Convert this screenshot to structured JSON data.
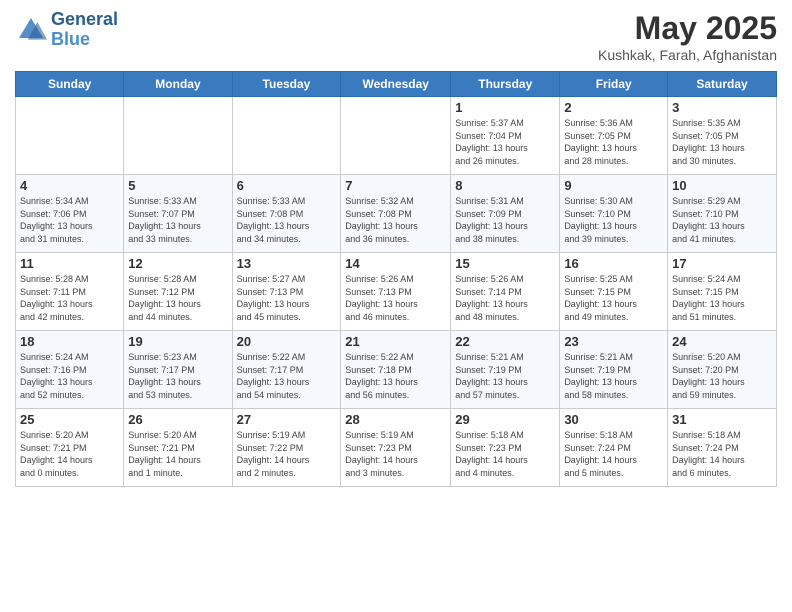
{
  "header": {
    "logo_line1": "General",
    "logo_line2": "Blue",
    "month": "May 2025",
    "location": "Kushkak, Farah, Afghanistan"
  },
  "weekdays": [
    "Sunday",
    "Monday",
    "Tuesday",
    "Wednesday",
    "Thursday",
    "Friday",
    "Saturday"
  ],
  "weeks": [
    [
      {
        "day": "",
        "info": ""
      },
      {
        "day": "",
        "info": ""
      },
      {
        "day": "",
        "info": ""
      },
      {
        "day": "",
        "info": ""
      },
      {
        "day": "1",
        "info": "Sunrise: 5:37 AM\nSunset: 7:04 PM\nDaylight: 13 hours\nand 26 minutes."
      },
      {
        "day": "2",
        "info": "Sunrise: 5:36 AM\nSunset: 7:05 PM\nDaylight: 13 hours\nand 28 minutes."
      },
      {
        "day": "3",
        "info": "Sunrise: 5:35 AM\nSunset: 7:05 PM\nDaylight: 13 hours\nand 30 minutes."
      }
    ],
    [
      {
        "day": "4",
        "info": "Sunrise: 5:34 AM\nSunset: 7:06 PM\nDaylight: 13 hours\nand 31 minutes."
      },
      {
        "day": "5",
        "info": "Sunrise: 5:33 AM\nSunset: 7:07 PM\nDaylight: 13 hours\nand 33 minutes."
      },
      {
        "day": "6",
        "info": "Sunrise: 5:33 AM\nSunset: 7:08 PM\nDaylight: 13 hours\nand 34 minutes."
      },
      {
        "day": "7",
        "info": "Sunrise: 5:32 AM\nSunset: 7:08 PM\nDaylight: 13 hours\nand 36 minutes."
      },
      {
        "day": "8",
        "info": "Sunrise: 5:31 AM\nSunset: 7:09 PM\nDaylight: 13 hours\nand 38 minutes."
      },
      {
        "day": "9",
        "info": "Sunrise: 5:30 AM\nSunset: 7:10 PM\nDaylight: 13 hours\nand 39 minutes."
      },
      {
        "day": "10",
        "info": "Sunrise: 5:29 AM\nSunset: 7:10 PM\nDaylight: 13 hours\nand 41 minutes."
      }
    ],
    [
      {
        "day": "11",
        "info": "Sunrise: 5:28 AM\nSunset: 7:11 PM\nDaylight: 13 hours\nand 42 minutes."
      },
      {
        "day": "12",
        "info": "Sunrise: 5:28 AM\nSunset: 7:12 PM\nDaylight: 13 hours\nand 44 minutes."
      },
      {
        "day": "13",
        "info": "Sunrise: 5:27 AM\nSunset: 7:13 PM\nDaylight: 13 hours\nand 45 minutes."
      },
      {
        "day": "14",
        "info": "Sunrise: 5:26 AM\nSunset: 7:13 PM\nDaylight: 13 hours\nand 46 minutes."
      },
      {
        "day": "15",
        "info": "Sunrise: 5:26 AM\nSunset: 7:14 PM\nDaylight: 13 hours\nand 48 minutes."
      },
      {
        "day": "16",
        "info": "Sunrise: 5:25 AM\nSunset: 7:15 PM\nDaylight: 13 hours\nand 49 minutes."
      },
      {
        "day": "17",
        "info": "Sunrise: 5:24 AM\nSunset: 7:15 PM\nDaylight: 13 hours\nand 51 minutes."
      }
    ],
    [
      {
        "day": "18",
        "info": "Sunrise: 5:24 AM\nSunset: 7:16 PM\nDaylight: 13 hours\nand 52 minutes."
      },
      {
        "day": "19",
        "info": "Sunrise: 5:23 AM\nSunset: 7:17 PM\nDaylight: 13 hours\nand 53 minutes."
      },
      {
        "day": "20",
        "info": "Sunrise: 5:22 AM\nSunset: 7:17 PM\nDaylight: 13 hours\nand 54 minutes."
      },
      {
        "day": "21",
        "info": "Sunrise: 5:22 AM\nSunset: 7:18 PM\nDaylight: 13 hours\nand 56 minutes."
      },
      {
        "day": "22",
        "info": "Sunrise: 5:21 AM\nSunset: 7:19 PM\nDaylight: 13 hours\nand 57 minutes."
      },
      {
        "day": "23",
        "info": "Sunrise: 5:21 AM\nSunset: 7:19 PM\nDaylight: 13 hours\nand 58 minutes."
      },
      {
        "day": "24",
        "info": "Sunrise: 5:20 AM\nSunset: 7:20 PM\nDaylight: 13 hours\nand 59 minutes."
      }
    ],
    [
      {
        "day": "25",
        "info": "Sunrise: 5:20 AM\nSunset: 7:21 PM\nDaylight: 14 hours\nand 0 minutes."
      },
      {
        "day": "26",
        "info": "Sunrise: 5:20 AM\nSunset: 7:21 PM\nDaylight: 14 hours\nand 1 minute."
      },
      {
        "day": "27",
        "info": "Sunrise: 5:19 AM\nSunset: 7:22 PM\nDaylight: 14 hours\nand 2 minutes."
      },
      {
        "day": "28",
        "info": "Sunrise: 5:19 AM\nSunset: 7:23 PM\nDaylight: 14 hours\nand 3 minutes."
      },
      {
        "day": "29",
        "info": "Sunrise: 5:18 AM\nSunset: 7:23 PM\nDaylight: 14 hours\nand 4 minutes."
      },
      {
        "day": "30",
        "info": "Sunrise: 5:18 AM\nSunset: 7:24 PM\nDaylight: 14 hours\nand 5 minutes."
      },
      {
        "day": "31",
        "info": "Sunrise: 5:18 AM\nSunset: 7:24 PM\nDaylight: 14 hours\nand 6 minutes."
      }
    ]
  ]
}
